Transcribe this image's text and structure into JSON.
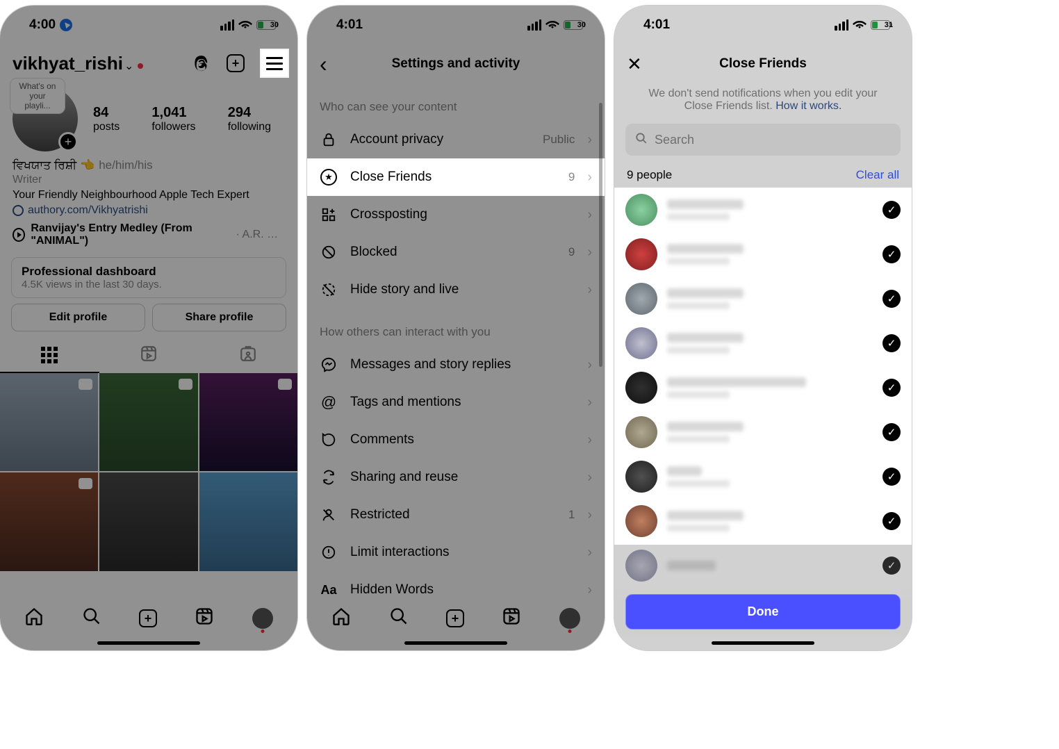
{
  "screen1": {
    "time": "4:00",
    "battery": "30",
    "username": "vikhyat_rishi",
    "story_note": "What's on your playli...",
    "name_native": "ਵਿਖਯਾਤ ਰਿਸ਼ੀ 👈",
    "pronouns": "he/him/his",
    "stats": {
      "posts_count": "84",
      "posts_label": "posts",
      "followers_count": "1,041",
      "followers_label": "followers",
      "following_count": "294",
      "following_label": "following"
    },
    "category": "Writer",
    "bio_line": "Your Friendly Neighbourhood Apple Tech Expert",
    "website": "authory.com/Vikhyatrishi",
    "music_title": "Ranvijay's Entry Medley (From \"ANIMAL\")",
    "music_artist": "· A.R. Ra...",
    "dashboard_title": "Professional dashboard",
    "dashboard_sub": "4.5K views in the last 30 days.",
    "edit_btn": "Edit profile",
    "share_btn": "Share profile"
  },
  "screen2": {
    "time": "4:01",
    "battery": "30",
    "title": "Settings and activity",
    "section1": "Who can see your content",
    "section2": "How others can interact with you",
    "rows": {
      "privacy_label": "Account privacy",
      "privacy_val": "Public",
      "friends_label": "Close Friends",
      "friends_val": "9",
      "cross_label": "Crossposting",
      "blocked_label": "Blocked",
      "blocked_val": "9",
      "hide_label": "Hide story and live",
      "msg_label": "Messages and story replies",
      "tags_label": "Tags and mentions",
      "comments_label": "Comments",
      "sharing_label": "Sharing and reuse",
      "restricted_label": "Restricted",
      "restricted_val": "1",
      "limit_label": "Limit interactions",
      "hidden_label": "Hidden Words"
    }
  },
  "screen3": {
    "time": "4:01",
    "battery": "31",
    "title": "Close Friends",
    "desc_pre": "We don't send notifications when you edit your Close Friends list. ",
    "desc_link": "How it works.",
    "search_placeholder": "Search",
    "count": "9 people",
    "clear": "Clear all",
    "done": "Done"
  }
}
